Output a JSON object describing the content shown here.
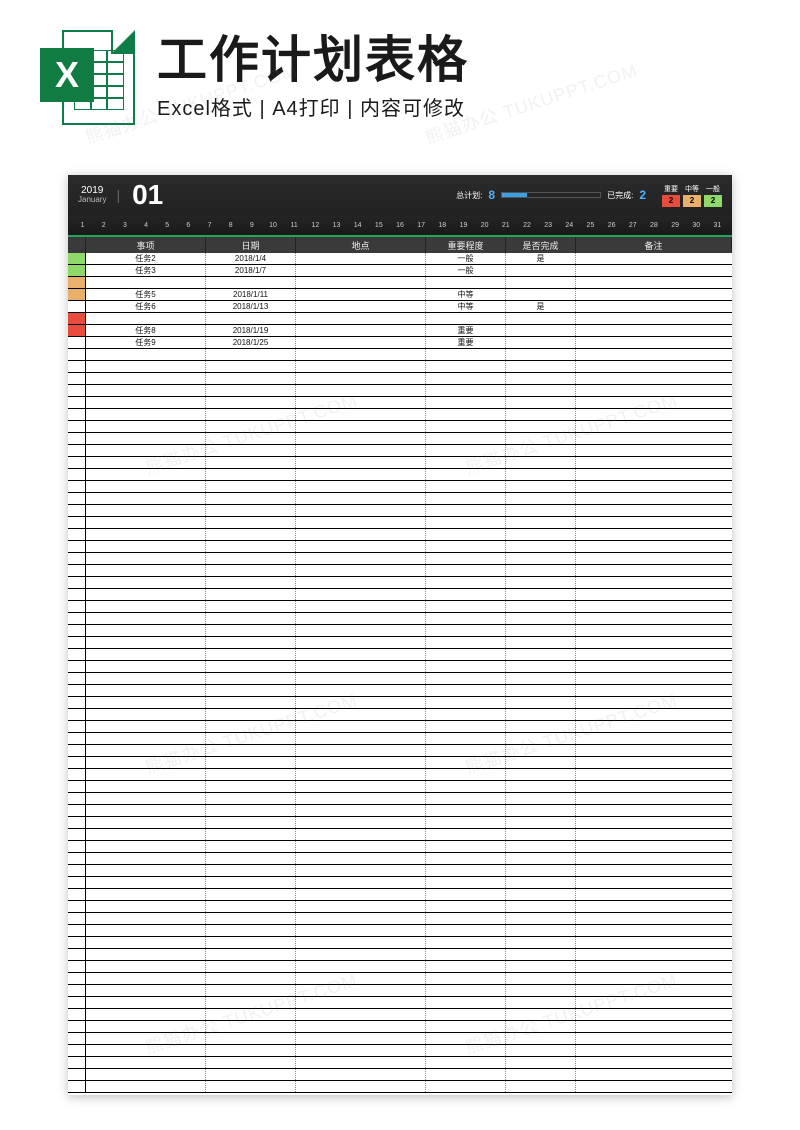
{
  "banner": {
    "title": "工作计划表格",
    "subtitle": "Excel格式 | A4打印 | 内容可修改",
    "icon_letter": "X"
  },
  "header": {
    "year": "2019",
    "month_en": "January",
    "month_num": "01",
    "stat_total_label": "总计划:",
    "stat_total_value": "8",
    "stat_done_label": "已完成:",
    "stat_done_value": "2",
    "legend": [
      {
        "label": "重要",
        "count": "2",
        "color": "c-red"
      },
      {
        "label": "中等",
        "count": "2",
        "color": "c-orange"
      },
      {
        "label": "一般",
        "count": "2",
        "color": "c-green"
      }
    ],
    "days": [
      "1",
      "2",
      "3",
      "4",
      "5",
      "6",
      "7",
      "8",
      "9",
      "10",
      "11",
      "12",
      "13",
      "14",
      "15",
      "16",
      "17",
      "18",
      "19",
      "20",
      "21",
      "22",
      "23",
      "24",
      "25",
      "26",
      "27",
      "28",
      "29",
      "30",
      "31"
    ]
  },
  "columns": [
    "",
    "事项",
    "日期",
    "地点",
    "重要程度",
    "是否完成",
    "备注"
  ],
  "tasks": [
    {
      "color": "#8ed96a",
      "name": "任务2",
      "date": "2018/1/4",
      "place": "",
      "priority": "一般",
      "done": "是",
      "note": ""
    },
    {
      "color": "#8ed96a",
      "name": "任务3",
      "date": "2018/1/7",
      "place": "",
      "priority": "一般",
      "done": "",
      "note": ""
    },
    {
      "color": "#e8b06b",
      "name": "",
      "date": "",
      "place": "",
      "priority": "",
      "done": "",
      "note": ""
    },
    {
      "color": "#e8b06b",
      "name": "任务5",
      "date": "2018/1/11",
      "place": "",
      "priority": "中等",
      "done": "",
      "note": ""
    },
    {
      "color": "",
      "name": "任务6",
      "date": "2018/1/13",
      "place": "",
      "priority": "中等",
      "done": "是",
      "note": ""
    },
    {
      "color": "#e74c3c",
      "name": "",
      "date": "",
      "place": "",
      "priority": "",
      "done": "",
      "note": ""
    },
    {
      "color": "#e74c3c",
      "name": "任务8",
      "date": "2018/1/19",
      "place": "",
      "priority": "重要",
      "done": "",
      "note": ""
    },
    {
      "color": "",
      "name": "任务9",
      "date": "2018/1/25",
      "place": "",
      "priority": "重要",
      "done": "",
      "note": ""
    }
  ],
  "empty_rows": 62,
  "watermark": "熊猫办公 TUKUPPT.COM"
}
